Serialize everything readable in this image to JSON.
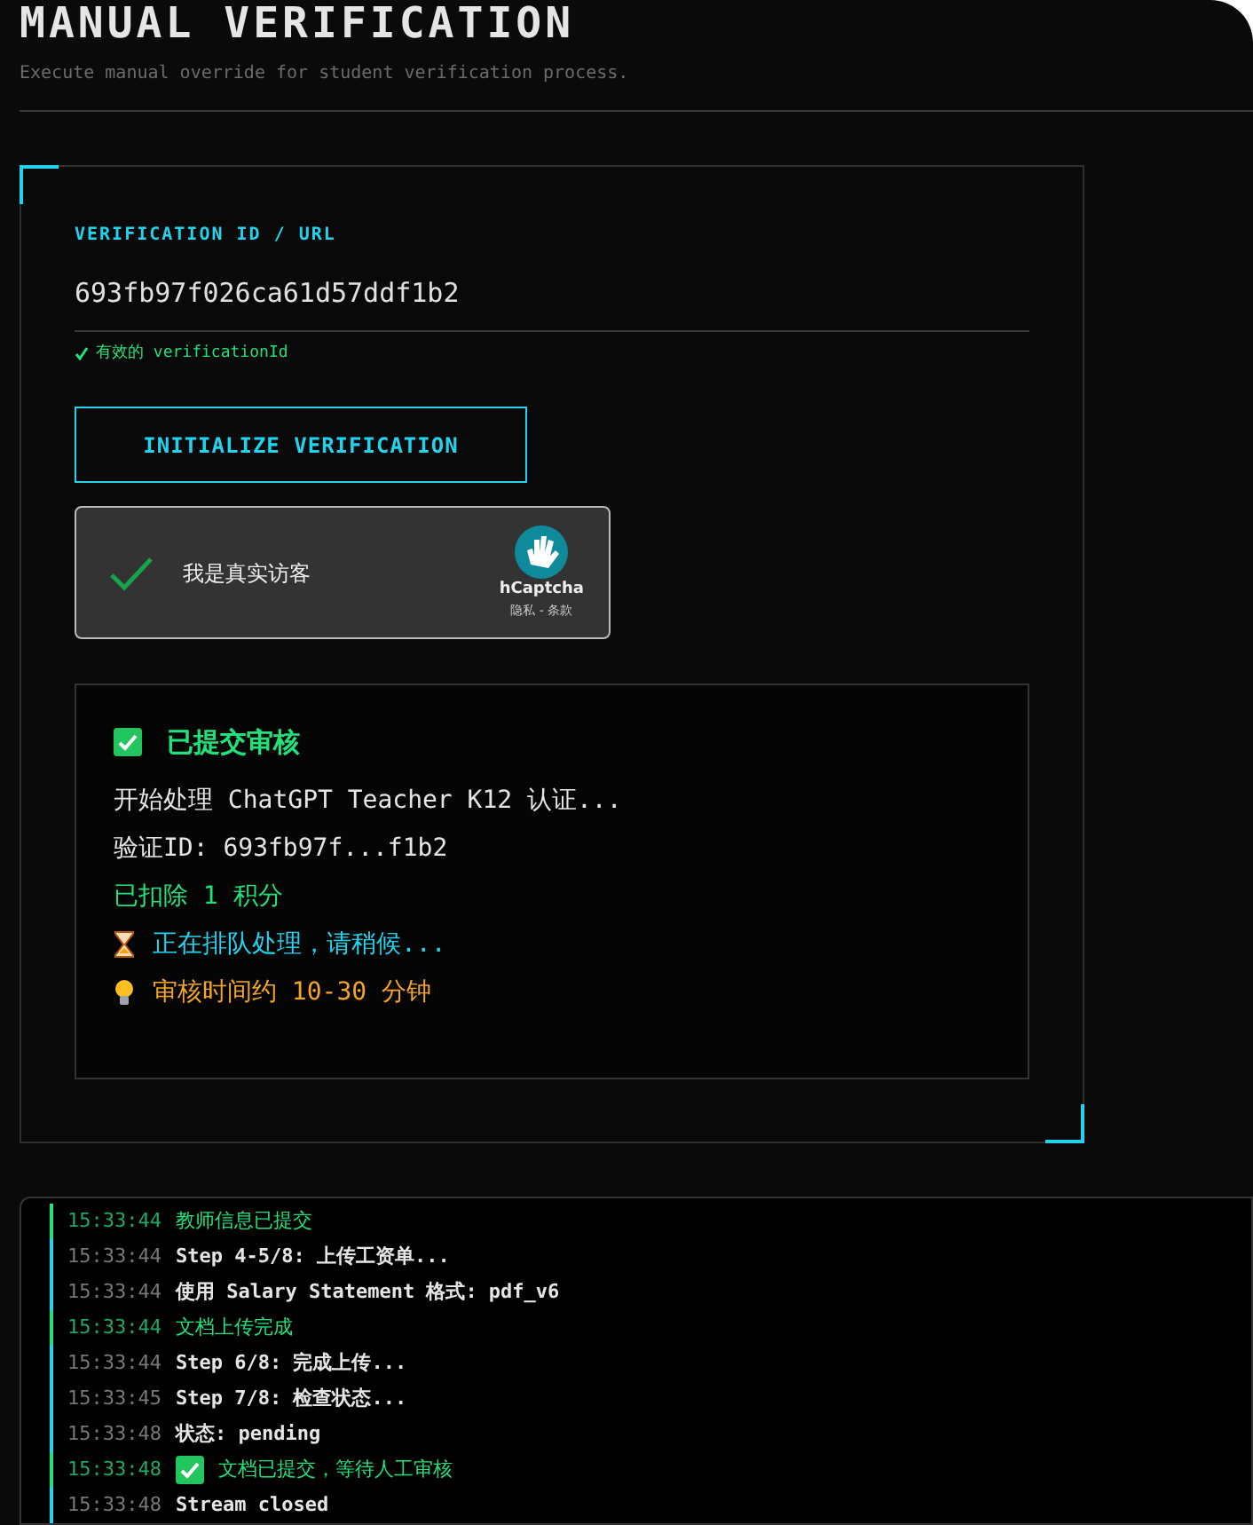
{
  "header": {
    "title": "MANUAL VERIFICATION",
    "subtitle": "Execute manual override for student verification process."
  },
  "form": {
    "label": "VERIFICATION ID / URL",
    "value": "693fb97f026ca61d57ddf1b2",
    "valid_note": "有效的 verificationId",
    "button": "INITIALIZE VERIFICATION"
  },
  "captcha": {
    "checked": true,
    "label": "我是真实访客",
    "brand": "hCaptcha",
    "links": "隐私 - 条款"
  },
  "result": {
    "title": "已提交审核",
    "lines": [
      {
        "kind": "plain",
        "text": "开始处理 ChatGPT Teacher K12 认证..."
      },
      {
        "kind": "plain",
        "text": "验证ID: 693fb97f...f1b2"
      },
      {
        "kind": "credit",
        "text": "已扣除 1 积分"
      },
      {
        "kind": "queue",
        "text": "正在排队处理，请稍候..."
      },
      {
        "kind": "tip",
        "text": "审核时间约 10-30 分钟"
      }
    ]
  },
  "log": [
    {
      "kind": "success",
      "time": "15:33:44",
      "text": "教师信息已提交"
    },
    {
      "kind": "info",
      "time": "15:33:44",
      "text": "Step 4-5/8: 上传工资单..."
    },
    {
      "kind": "info",
      "time": "15:33:44",
      "text": "使用 Salary Statement 格式: pdf_v6"
    },
    {
      "kind": "success",
      "time": "15:33:44",
      "text": "文档上传完成"
    },
    {
      "kind": "info",
      "time": "15:33:44",
      "text": "Step 6/8: 完成上传..."
    },
    {
      "kind": "info",
      "time": "15:33:45",
      "text": "Step 7/8: 检查状态..."
    },
    {
      "kind": "info",
      "time": "15:33:48",
      "text": "状态: pending"
    },
    {
      "kind": "submitted",
      "time": "15:33:48",
      "text": "文档已提交，等待人工审核"
    },
    {
      "kind": "info",
      "time": "15:33:48",
      "text": "Stream closed"
    }
  ]
}
